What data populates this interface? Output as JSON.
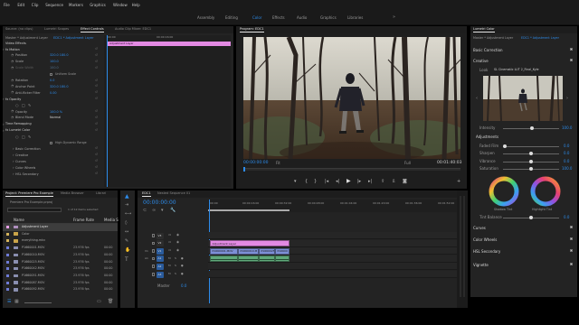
{
  "menubar": [
    "File",
    "Edit",
    "Clip",
    "Sequence",
    "Markers",
    "Graphics",
    "Window",
    "Help"
  ],
  "workspaces": [
    {
      "label": "Assembly",
      "active": false
    },
    {
      "label": "Editing",
      "active": false
    },
    {
      "label": "Color",
      "active": true
    },
    {
      "label": "Effects",
      "active": false
    },
    {
      "label": "Audio",
      "active": false
    },
    {
      "label": "Graphics",
      "active": false
    },
    {
      "label": "Libraries",
      "active": false
    }
  ],
  "source_panel": {
    "tabs": [
      {
        "label": "Source: (no clips)",
        "active": false
      },
      {
        "label": "Lumetri Scopes",
        "active": false
      },
      {
        "label": "Effect Controls",
        "active": true
      },
      {
        "label": "Audio Clip Mixer: EDC1",
        "active": false
      }
    ],
    "clip_path": "Master * Adjustment Layer",
    "sequence_path": "EDC1 * Adjustment Layer",
    "video_effects_label": "Video Effects",
    "timecode_start": "00:00",
    "timecode_mid": "00:00:16:00",
    "clip_bar_label": "Adjustment Layer",
    "rows": [
      {
        "name": "fx  Motion",
        "value": "",
        "kind": "group"
      },
      {
        "name": "Position",
        "value": "320.0   180.0",
        "kind": "prop"
      },
      {
        "name": "Scale",
        "value": "100.0",
        "kind": "prop"
      },
      {
        "name": "Scale Width",
        "value": "100.0",
        "kind": "dim"
      },
      {
        "name": "",
        "value": "Uniform Scale",
        "kind": "check"
      },
      {
        "name": "Rotation",
        "value": "0.0",
        "kind": "prop"
      },
      {
        "name": "Anchor Point",
        "value": "320.0   180.0",
        "kind": "prop"
      },
      {
        "name": "Anti-flicker Filter",
        "value": "0.00",
        "kind": "prop"
      },
      {
        "name": "fx  Opacity",
        "value": "",
        "kind": "group"
      },
      {
        "name": "",
        "value": "",
        "kind": "masks"
      },
      {
        "name": "Opacity",
        "value": "100.0 %",
        "kind": "prop"
      },
      {
        "name": "Blend Mode",
        "value": "Normal",
        "kind": "select"
      },
      {
        "name": "Time Remapping",
        "value": "",
        "kind": "group"
      },
      {
        "name": "fx  Lumetri Color",
        "value": "",
        "kind": "group"
      },
      {
        "name": "",
        "value": "",
        "kind": "masks"
      },
      {
        "name": "",
        "value": "High Dynamic Range",
        "kind": "check"
      },
      {
        "name": "Basic Correction",
        "value": "",
        "kind": "sub"
      },
      {
        "name": "Creative",
        "value": "",
        "kind": "sub"
      },
      {
        "name": "Curves",
        "value": "",
        "kind": "sub"
      },
      {
        "name": "Color Wheels",
        "value": "",
        "kind": "sub"
      },
      {
        "name": "HSL Secondary",
        "value": "",
        "kind": "sub"
      }
    ]
  },
  "program": {
    "title": "Program: EDC1",
    "timecode_left": "00:00:00:00",
    "fit": "Fit",
    "quality": "Full",
    "timecode_right": "00:01:40:03"
  },
  "project": {
    "tabs": [
      {
        "label": "Project: Premiere Pro Example",
        "active": true
      },
      {
        "label": "Media Browser",
        "active": false
      },
      {
        "label": "Librari",
        "active": false
      }
    ],
    "filename": "Premiere Pro Example.prproj",
    "selection_count": "1 of 12 items selected",
    "col_name": "Name",
    "col_rate": "Frame Rate",
    "col_start": "Media S",
    "items": [
      {
        "name": "Adjustment Layer",
        "rate": "",
        "start": "",
        "color": "#e6a0e6",
        "folder": false,
        "selected": true
      },
      {
        "name": "Color",
        "rate": "",
        "start": "",
        "color": "#d4b35a",
        "folder": true,
        "selected": false
      },
      {
        "name": "everything.mkv",
        "rate": "",
        "start": "",
        "color": "#d4b35a",
        "folder": true,
        "selected": false
      },
      {
        "name": "P1660001.MOV",
        "rate": "23.976 fps",
        "start": "00:00",
        "color": "#6e7bd6",
        "folder": false,
        "selected": false
      },
      {
        "name": "P1660010.MOV",
        "rate": "23.976 fps",
        "start": "00:00",
        "color": "#6e7bd6",
        "folder": false,
        "selected": false
      },
      {
        "name": "P1660025.MOV",
        "rate": "23.976 fps",
        "start": "00:00",
        "color": "#6e7bd6",
        "folder": false,
        "selected": false
      },
      {
        "name": "P1660042.MOV",
        "rate": "23.976 fps",
        "start": "00:00",
        "color": "#6e7bd6",
        "folder": false,
        "selected": false
      },
      {
        "name": "P1660051.MOV",
        "rate": "23.976 fps",
        "start": "00:00",
        "color": "#6e7bd6",
        "folder": false,
        "selected": false
      },
      {
        "name": "P1660087.MOV",
        "rate": "23.976 fps",
        "start": "00:00",
        "color": "#6e7bd6",
        "folder": false,
        "selected": false
      },
      {
        "name": "P1660092.MOV",
        "rate": "23.976 fps",
        "start": "00:00",
        "color": "#6e7bd6",
        "folder": false,
        "selected": false
      }
    ]
  },
  "timeline": {
    "tabs": [
      {
        "label": "EDC1",
        "active": true
      },
      {
        "label": "Nested Sequence 01",
        "active": false
      }
    ],
    "playhead": "00:00:00:00",
    "ruler": [
      "00:00",
      "00:00:16:00",
      "00:00:32:00",
      "00:00:48:00",
      "00:01:04:00",
      "00:01:20:00",
      "00:01:36:00",
      "00:01:52:00"
    ],
    "tracks": [
      {
        "name": "V3",
        "kind": "video"
      },
      {
        "name": "V2",
        "kind": "video"
      },
      {
        "name": "V1",
        "kind": "video"
      },
      {
        "name": "A1",
        "kind": "audio"
      },
      {
        "name": "A2",
        "kind": "audio"
      },
      {
        "name": "A3",
        "kind": "audio"
      }
    ],
    "master_label": "Master",
    "master_value": "0.0",
    "clip_adjustment": "Adjustment Layer",
    "clips_v1": [
      "P1660001.MOV",
      "P1660010.M",
      "P1660025",
      "P16600"
    ]
  },
  "lumetri": {
    "title": "Lumetri Color",
    "clip_path": "Master * Adjustment Layer",
    "sequence_path": "EDC1 * Adjustment Layer",
    "sections": {
      "basic": "Basic Correction",
      "creative": "Creative",
      "curves": "Curves",
      "wheels": "Color Wheels",
      "hsl": "HSL Secondary",
      "vignette": "Vignette"
    },
    "look_label": "Look",
    "look_value": "SL Cinematic LUT 2_Final_Kyle",
    "intensity_label": "Intensity",
    "intensity_value": "100.0",
    "adjustments_label": "Adjustments",
    "sliders": [
      {
        "label": "Faded Film",
        "value": "0.0",
        "position": 0.0
      },
      {
        "label": "Sharpen",
        "value": "0.0",
        "position": 0.5
      },
      {
        "label": "Vibrance",
        "value": "0.0",
        "position": 0.5
      },
      {
        "label": "Saturation",
        "value": "100.0",
        "position": 0.5
      }
    ],
    "shadow_tint": "Shadow Tint",
    "highlight_tint": "Highlight Tint",
    "tint_balance_label": "Tint Balance",
    "tint_balance_value": "0.0"
  },
  "colors": {
    "accent_blue": "#2d8ceb",
    "clip_pink": "#e38ae3",
    "clip_blue": "#7d8fd6",
    "clip_green": "#5fa87a"
  }
}
